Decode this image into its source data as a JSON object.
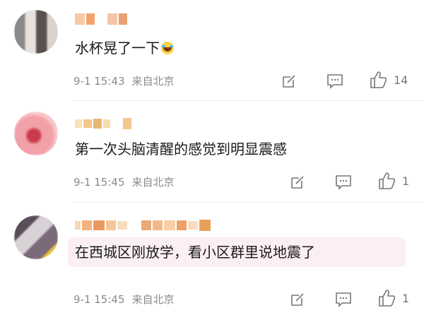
{
  "comments": [
    {
      "text": "水杯晃了一下",
      "emoji": "laugh-cry-emoji",
      "time": "9-1 15:43",
      "location": "来自北京",
      "likes": "14"
    },
    {
      "text": "第一次头脑清醒的感觉到明显震感",
      "time": "9-1 15:45",
      "location": "来自北京",
      "likes": "1"
    },
    {
      "text": "在西城区刚放学，看小区群里说地震了",
      "time": "9-1 15:45",
      "location": "来自北京",
      "likes": "1"
    }
  ],
  "colors": {
    "meta_text": "#8a8a8a",
    "highlight_bubble": "#fbeff1",
    "icon": "#777777"
  }
}
